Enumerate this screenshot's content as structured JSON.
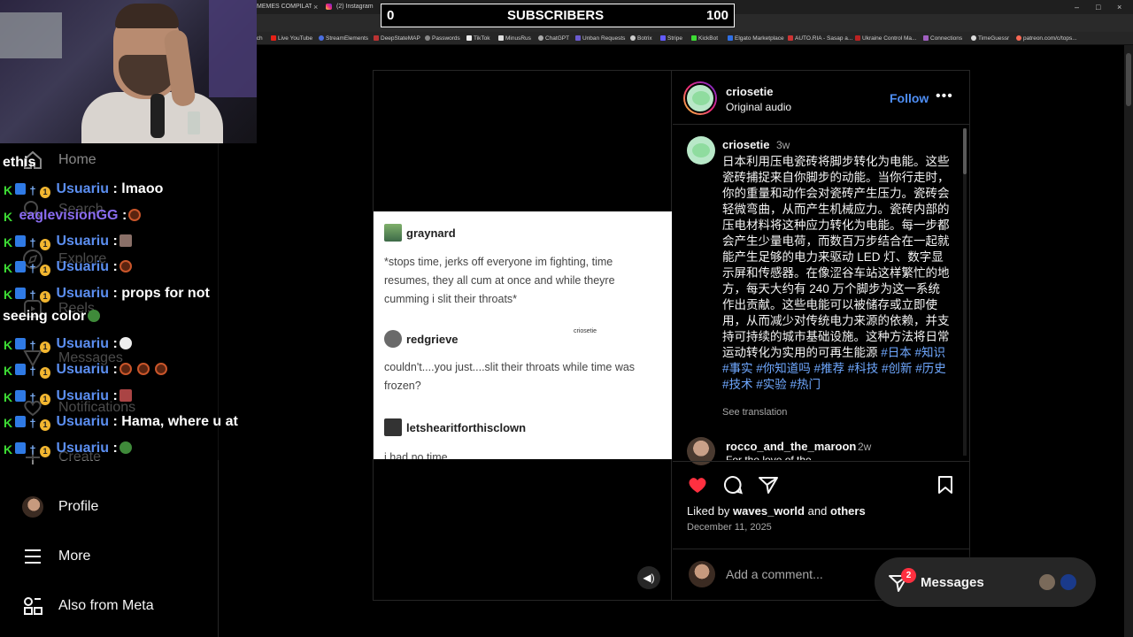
{
  "browser": {
    "tabs": [
      {
        "title": "MEMES COMPILATION"
      },
      {
        "title": "(2) Instagram"
      }
    ],
    "bookmarks": [
      "tch",
      "Live YouTube",
      "StreamElements",
      "DeepStateMAP",
      "Passwords",
      "TikTok",
      "MinusRus",
      "ChatGPT",
      "Unban Requests",
      "Botrix",
      "Stripe",
      "KickBot",
      "Elgato Marketplace",
      "AUTO.RIA - Sasap a...",
      "Ukraine Control Ma...",
      "Connections",
      "TimeGuessr",
      "patreon.com/c/tops..."
    ]
  },
  "subscriber_goal": {
    "start": "0",
    "label": "SUBSCRIBERS",
    "end": "100"
  },
  "sidebar": {
    "items": [
      {
        "label": "Home",
        "icon": "home-icon"
      },
      {
        "label": "Search",
        "icon": "search-icon"
      },
      {
        "label": "Explore",
        "icon": "compass-icon"
      },
      {
        "label": "Reels",
        "icon": "reels-icon"
      },
      {
        "label": "Messages",
        "icon": "messenger-icon"
      },
      {
        "label": "Notifications",
        "icon": "heart-icon"
      },
      {
        "label": "Create",
        "icon": "plus-icon"
      },
      {
        "label": "Profile",
        "icon": "profile-avatar"
      },
      {
        "label": "More",
        "icon": "hamburger-icon"
      },
      {
        "label": "Also from Meta",
        "icon": "meta-apps-icon"
      }
    ]
  },
  "chat": {
    "lines": [
      {
        "user": "",
        "text": "ethis"
      },
      {
        "user": "Usuariu",
        "text": ": lmaoo"
      },
      {
        "user": "eaglevisionGG",
        "text": ":"
      },
      {
        "user": "Usuariu",
        "text": ":"
      },
      {
        "user": "Usuariu",
        "text": ":"
      },
      {
        "user": "Usuariu",
        "text": ": props for not"
      },
      {
        "user": "",
        "text": "seeing color"
      },
      {
        "user": "Usuariu",
        "text": ":"
      },
      {
        "user": "Usuariu",
        "text": ":"
      },
      {
        "user": "Usuariu",
        "text": ":"
      },
      {
        "user": "Usuariu",
        "text": ": Hama, where u at"
      },
      {
        "user": "Usuariu",
        "text": ":"
      }
    ]
  },
  "post": {
    "author": "criosetie",
    "audio": "Original audio",
    "follow_label": "Follow",
    "tumblr": [
      {
        "user": "graynard",
        "text": "*stops time, jerks off everyone im fighting, time resumes, they all cum at once and while theyre cumming i slit their throats*"
      },
      {
        "user": "redgrieve",
        "text": "couldn't....you just....slit their throats while time was frozen?"
      },
      {
        "user": "letshearitforthisclown",
        "text": "i had no time"
      }
    ],
    "watermark": "criosetie",
    "caption": {
      "user": "criosetie",
      "time": "3w",
      "text": "日本利用压电瓷砖将脚步转化为电能。这些瓷砖捕捉来自你脚步的动能。当你行走时，你的重量和动作会对瓷砖产生压力。瓷砖会轻微弯曲，从而产生机械应力。瓷砖内部的压电材料将这种应力转化为电能。每一步都会产生少量电荷，而数百万步结合在一起就能产生足够的电力来驱动 LED 灯、数字显示屏和传感器。在像涩谷车站这样繁忙的地方，每天大约有 240 万个脚步为这一系统作出贡献。这些电能可以被储存或立即使用，从而减少对传统电力来源的依赖，并支持可持续的城市基础设施。这种方法将日常运动转化为实用的可再生能源",
      "hashtags": "#日本 #知识 #事实 #你知道吗 #推荐 #科技 #创新 #历史 #技术 #实验 #热门",
      "see_translation": "See translation"
    },
    "comment": {
      "user": "rocco_and_the_maroon",
      "time": "2w",
      "text": "For the love of the"
    },
    "liked_by_prefix": "Liked by",
    "liked_by_user": "waves_world",
    "liked_by_and": "and",
    "liked_by_others": "others",
    "date": "December 11, 2025",
    "add_comment_placeholder": "Add a comment..."
  },
  "messages_pill": {
    "label": "Messages",
    "badge": "2"
  },
  "colors": {
    "accent": "#4e8ef5",
    "like": "#ff3040",
    "hashtag": "#6fa8ff",
    "kick_green": "#3ddc34"
  }
}
